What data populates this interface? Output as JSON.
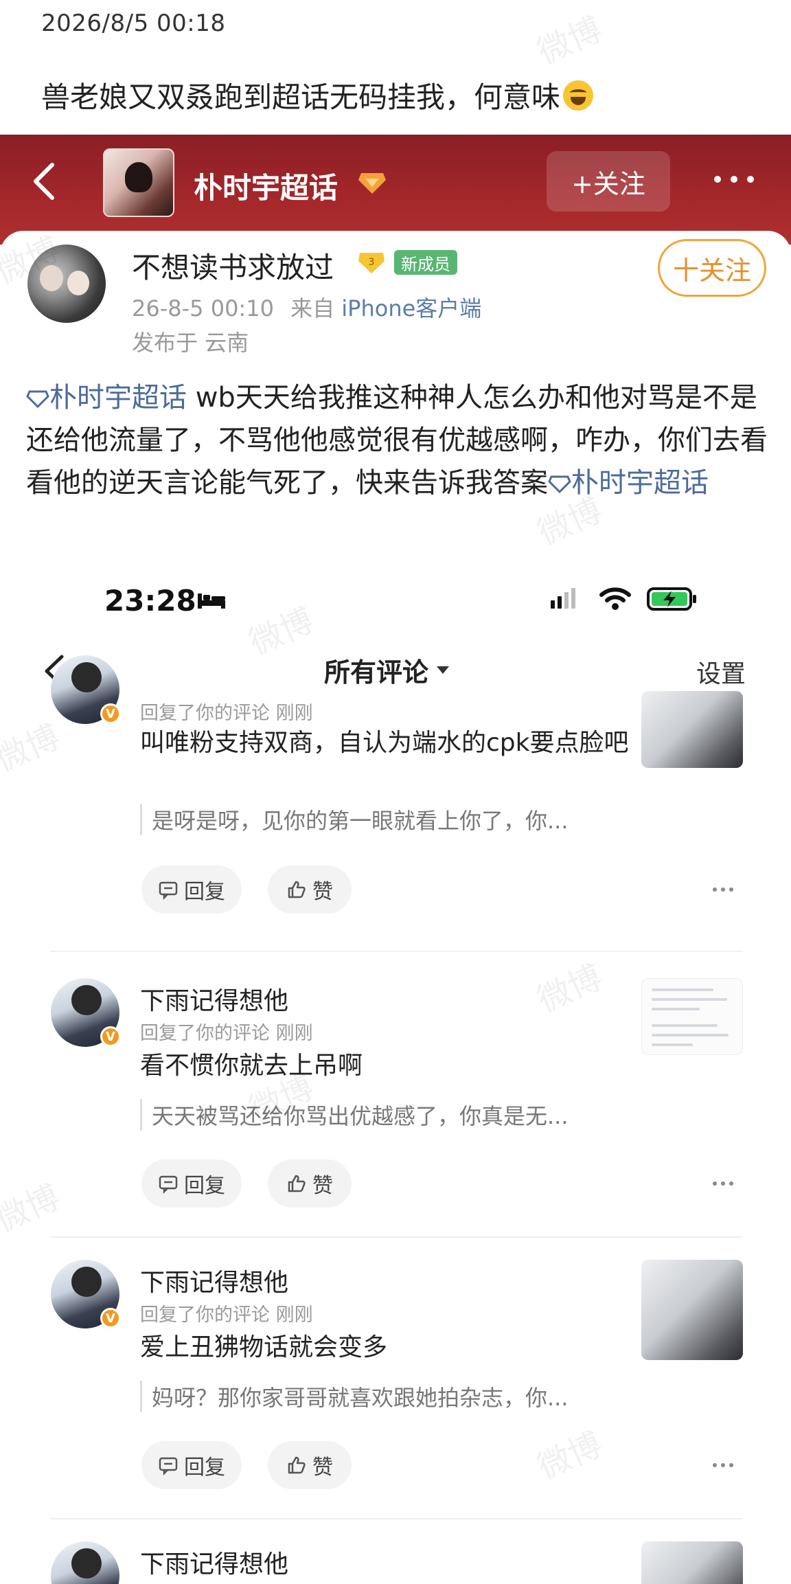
{
  "caption": {
    "timestamp": "2026/8/5 00:18",
    "text": "兽老娘又双叒跑到超话无码挂我，何意味",
    "emoji": "laughing-tears-emoji"
  },
  "topic_header": {
    "title": "朴时宇超话",
    "follow_label": "+关注"
  },
  "post": {
    "user_name": "不想读书求放过",
    "badge": "新成员",
    "follow_label": "十关注",
    "time": "26-8-5 00:10",
    "source_prefix": "来自",
    "source": "iPhone客户端",
    "location": "发布于 云南",
    "topic_tag": "朴时宇超话",
    "body": "   wb天天给我推这种神人怎么办和他对骂是不是还给他流量了，不骂他他感觉很有优越感啊，咋办，你们去看看他的逆天言论能气死了，快来告诉我答案",
    "topic_tag_end": "朴时宇超话"
  },
  "screenshot": {
    "status_time": "23:28",
    "nav_title": "所有评论",
    "nav_settings": "设置",
    "comments": [
      {
        "name": "",
        "meta": "回复了你的评论  刚刚",
        "text": "叫唯粉支持双商，自认为端水的cpk要点脸吧",
        "quote": "是呀是呀，见你的第一眼就看上你了，你...",
        "reply_label": "回复",
        "like_label": "赞"
      },
      {
        "name": "下雨记得想他",
        "meta": "回复了你的评论  刚刚",
        "text": "看不惯你就去上吊啊",
        "quote": "天天被骂还给你骂出优越感了，你真是无...",
        "reply_label": "回复",
        "like_label": "赞"
      },
      {
        "name": "下雨记得想他",
        "meta": "回复了你的评论  刚刚",
        "text": "爱上丑狒物话就会变多",
        "quote": "妈呀？那你家哥哥就喜欢跟她拍杂志，你...",
        "reply_label": "回复",
        "like_label": "赞"
      },
      {
        "name": "下雨记得想他"
      }
    ]
  },
  "watermark_text": "微博",
  "colors": {
    "header_red": "#a3262a",
    "topic_link": "#4d6b9a",
    "follow_orange": "#e8902a",
    "newbie_green": "#58b673"
  }
}
